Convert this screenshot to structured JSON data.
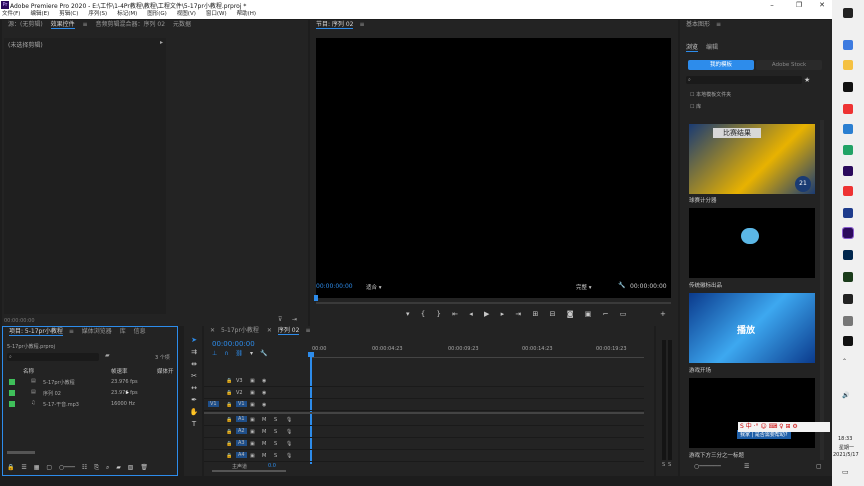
{
  "titlebar": {
    "title": "Adobe Premiere Pro 2020 - E:\\工作\\1-4Pr教程\\教程\\工程文件\\5-17pr小教程.prproj *"
  },
  "menu": [
    "文件(F)",
    "编辑(E)",
    "剪辑(C)",
    "序列(S)",
    "标记(M)",
    "图形(G)",
    "视图(V)",
    "窗口(W)",
    "帮助(H)"
  ],
  "source_panel": {
    "tabs": [
      "源：(无剪辑)",
      "效果控件",
      "音频剪辑混合器：序列 02",
      "元数据"
    ],
    "active": "效果控件",
    "clip_label": "(未选择剪辑)",
    "time": "00:00:00:00"
  },
  "program": {
    "title": "节目: 序列 02",
    "time_left": "00:00:00:00",
    "fit": "适合",
    "quality": "完整",
    "time_right": "00:00:00:00"
  },
  "project": {
    "tabs": [
      "项目: 5-17pr小教程",
      "媒体浏览器",
      "库",
      "信息"
    ],
    "file": "5-17pr小教程.prproj",
    "search": "",
    "count": "3 个项",
    "columns": [
      "名称",
      "帧速率",
      "媒体开"
    ],
    "items": [
      {
        "name": "5-17pr小教程",
        "rate": "23.976 fps",
        "color": "#3fbf5a"
      },
      {
        "name": "序列 02",
        "rate": "23.976 fps",
        "color": "#3fbf5a"
      },
      {
        "name": "5-17-干音.mp3",
        "rate": "16000 Hz",
        "color": "#3fbf5a"
      }
    ]
  },
  "timeline": {
    "tabs": [
      "5-17pr小教程",
      "序列 02"
    ],
    "active": "序列 02",
    "time": "00:00:00:00",
    "ruler": [
      "00:00",
      "00:00:04:23",
      "00:00:09:23",
      "00:00:14:23",
      "00:00:19:23"
    ],
    "video_tracks": [
      "V3",
      "V2",
      "V1"
    ],
    "audio_tracks": [
      "A1",
      "A2",
      "A3",
      "A4"
    ],
    "master": "主声道",
    "master_val": "0.0",
    "src_patch": "V1"
  },
  "meters": {
    "labels": [
      "S",
      "S"
    ]
  },
  "essential": {
    "title": "基本图形",
    "tabs": [
      "浏览",
      "编辑"
    ],
    "active": "浏览",
    "btn1": "我的模板",
    "btn2": "Adobe Stock",
    "check1": "本地模板文件夹",
    "check2": "库",
    "templates": [
      {
        "name": "球赛计分器",
        "thumb_text": "比赛结果"
      },
      {
        "name": "传统徽标出品",
        "thumb_text": ""
      },
      {
        "name": "游戏开场",
        "thumb_text": "播放"
      },
      {
        "name": "游戏下方三分之一标题",
        "thumb_text": "我家 | 是否需要帮助?"
      }
    ]
  },
  "tray": {
    "time": "18:33",
    "weekday": "星期一",
    "date": "2021/5/17"
  },
  "colors": {
    "accent": "#2d8ceb",
    "bg": "#1d1d1d",
    "panel": "#232323"
  }
}
